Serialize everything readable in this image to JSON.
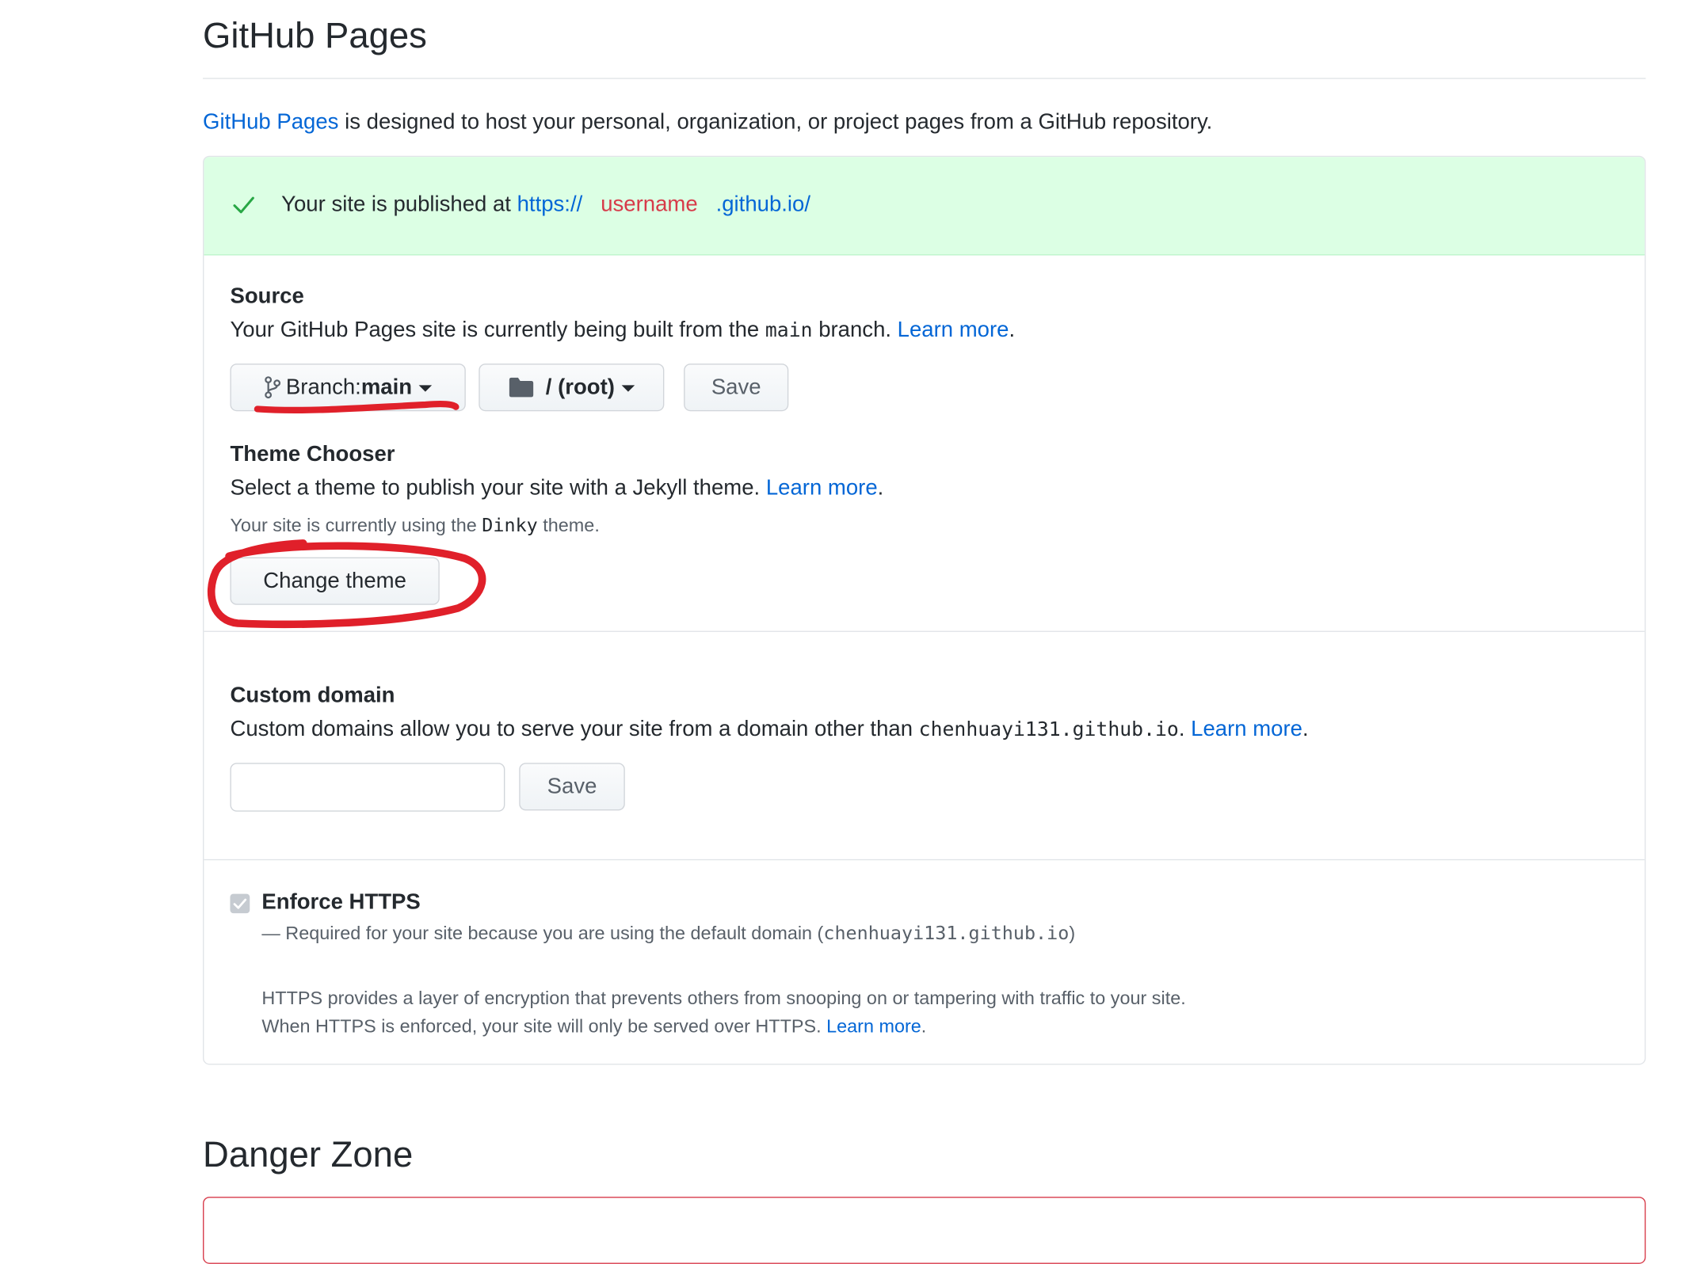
{
  "page": {
    "title": "GitHub Pages",
    "intro_link": "GitHub Pages",
    "intro_text": " is designed to host your personal, organization, or project pages from a GitHub repository."
  },
  "flash": {
    "icon": "check-icon",
    "prefix": "Your site is published at ",
    "url_scheme": "https://",
    "url_user": "username",
    "url_domain": ".github.io/",
    "colors": {
      "background": "#dcffe4",
      "check": "#28a745",
      "redacted": "#d73a49"
    }
  },
  "source": {
    "title": "Source",
    "text_before": "Your GitHub Pages site is currently being built from the ",
    "branch_code": "main",
    "text_after": " branch. ",
    "learn_more": "Learn more",
    "period": ".",
    "branch_button": {
      "icon": "git-branch-icon",
      "label": "Branch: ",
      "value": "main"
    },
    "folder_button": {
      "icon": "folder-icon",
      "label": "/ (root)"
    },
    "save_button": "Save"
  },
  "theme": {
    "title": "Theme Chooser",
    "text": "Select a theme to publish your site with a Jekyll theme. ",
    "learn_more": "Learn more",
    "period": ".",
    "note_before": "Your site is currently using the ",
    "theme_name": "Dinky",
    "note_after": " theme.",
    "change_button": "Change theme"
  },
  "custom_domain": {
    "title": "Custom domain",
    "text": "Custom domains allow you to serve your site from a domain other than ",
    "domain": "chenhuayi131.github.io",
    "text_after": ". ",
    "learn_more": "Learn more",
    "period": ".",
    "input_value": "",
    "save_button": "Save"
  },
  "https": {
    "checked": true,
    "title": "Enforce HTTPS",
    "required_prefix": "— Required for your site because you are using the default domain (",
    "domain": "chenhuayi131.github.io",
    "required_suffix": ")",
    "desc_line1": "HTTPS provides a layer of encryption that prevents others from snooping on or tampering with traffic to your site.",
    "desc_line2": "When HTTPS is enforced, your site will only be served over HTTPS. ",
    "learn_more": "Learn more",
    "period": "."
  },
  "danger": {
    "title": "Danger Zone",
    "border_color": "#d73a49"
  },
  "annotation_color": "#e0202a"
}
